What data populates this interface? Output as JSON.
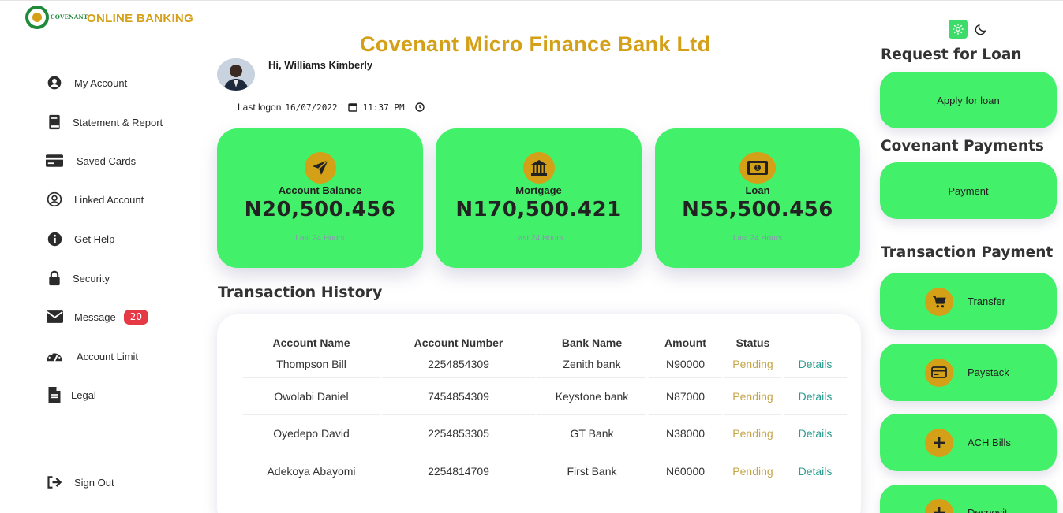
{
  "brand": {
    "logo_text": "COVENANT",
    "title": "ONLINE BANKING"
  },
  "bank_title": "Covenant Micro Finance Bank Ltd",
  "sidebar": {
    "items": [
      {
        "label": "My Account",
        "icon": "user-circle-icon"
      },
      {
        "label": "Statement & Report",
        "icon": "book-icon"
      },
      {
        "label": "Saved Cards",
        "icon": "credit-card-icon"
      },
      {
        "label": "Linked Account",
        "icon": "user-circle-outline-icon"
      },
      {
        "label": "Get Help",
        "icon": "info-icon"
      },
      {
        "label": "Security",
        "icon": "lock-icon"
      },
      {
        "label": "Message",
        "icon": "envelope-icon",
        "badge": "20"
      },
      {
        "label": "Account Limit",
        "icon": "gauge-icon"
      },
      {
        "label": "Legal",
        "icon": "document-icon"
      }
    ],
    "sign_out": "Sign Out"
  },
  "user": {
    "greeting": "Hi, Williams Kimberly"
  },
  "logon": {
    "label": "Last logon",
    "date": "16/07/2022",
    "time": "11:37 PM"
  },
  "cards": [
    {
      "label": "Account Balance",
      "value": "N20,500.456",
      "sub": "Last 24 Hours",
      "icon": "paper-plane-icon"
    },
    {
      "label": "Mortgage",
      "value": "N170,500.421",
      "sub": "Last 24 Hours",
      "icon": "bank-building-icon"
    },
    {
      "label": "Loan",
      "value": "N55,500.456",
      "sub": "Last 24 Hours",
      "icon": "money-bill-icon"
    }
  ],
  "transactions": {
    "title": "Transaction History",
    "headers": [
      "Account Name",
      "Account Number",
      "Bank Name",
      "Amount",
      "Status"
    ],
    "rows": [
      {
        "name": "Thompson Bill",
        "number": "2254854309",
        "bank": "Zenith bank",
        "amount": "N90000",
        "status": "Pending",
        "action": "Details"
      },
      {
        "name": "Owolabi Daniel",
        "number": "7454854309",
        "bank": "Keystone bank",
        "amount": "N87000",
        "status": "Pending",
        "action": "Details"
      },
      {
        "name": "Oyedepo David",
        "number": "2254853305",
        "bank": "GT Bank",
        "amount": "N38000",
        "status": "Pending",
        "action": "Details"
      },
      {
        "name": "Adekoya Abayomi",
        "number": "2254814709",
        "bank": "First Bank",
        "amount": "N60000",
        "status": "Pending",
        "action": "Details"
      }
    ]
  },
  "right_panel": {
    "loan_title": "Request for Loan",
    "loan_button": "Apply for loan",
    "payments_title": "Covenant Payments",
    "payment_button": "Payment",
    "transaction_title": "Transaction Payment",
    "buttons": [
      {
        "label": "Transfer",
        "icon": "cart-icon"
      },
      {
        "label": "Paystack",
        "icon": "card-icon"
      },
      {
        "label": "ACH Bills",
        "icon": "plus-icon"
      },
      {
        "label": "Desposit",
        "icon": "plus-icon"
      }
    ]
  },
  "colors": {
    "accent_green": "#43f06a",
    "gold": "#d4a017",
    "badge_red": "#e63946",
    "pending": "#c4a54a",
    "details": "#2a9d8f"
  }
}
